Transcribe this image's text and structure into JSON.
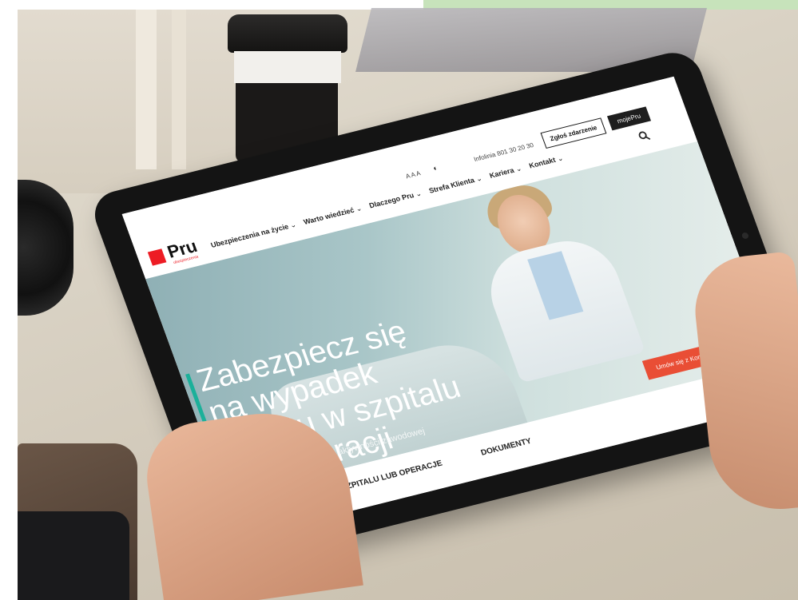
{
  "website": {
    "logo": {
      "brand": "Pru",
      "sub": "ubezpieczenia"
    },
    "utility": {
      "font_size_control": "A A A",
      "contrast_icon": "contrast-icon",
      "phone": "Infolinia 801 30 20 30",
      "claim_button": "Zgłoś zdarzenie",
      "login_button": "mojePru",
      "search_icon": "search-icon"
    },
    "nav": {
      "items": [
        "Ubezpieczenia na życie",
        "Warto wiedzieć",
        "Dlaczego Pru",
        "Strefa Klienta",
        "Kariera",
        "Kontakt"
      ]
    },
    "hero": {
      "title": "Zabezpiecz się na wypadek pobytu w szpitalu lub operacji",
      "subtitle": "Szybki powrót do zdrowia i aktywności zawodowej jest ważny",
      "cta": "Umów się z Konsultantem",
      "accent_color": "#1bb09a",
      "cta_color": "#e94e35"
    },
    "tabs": {
      "items": [
        "W SZPITALU LUB OPERACJE",
        "DOKUMENTY"
      ]
    }
  }
}
